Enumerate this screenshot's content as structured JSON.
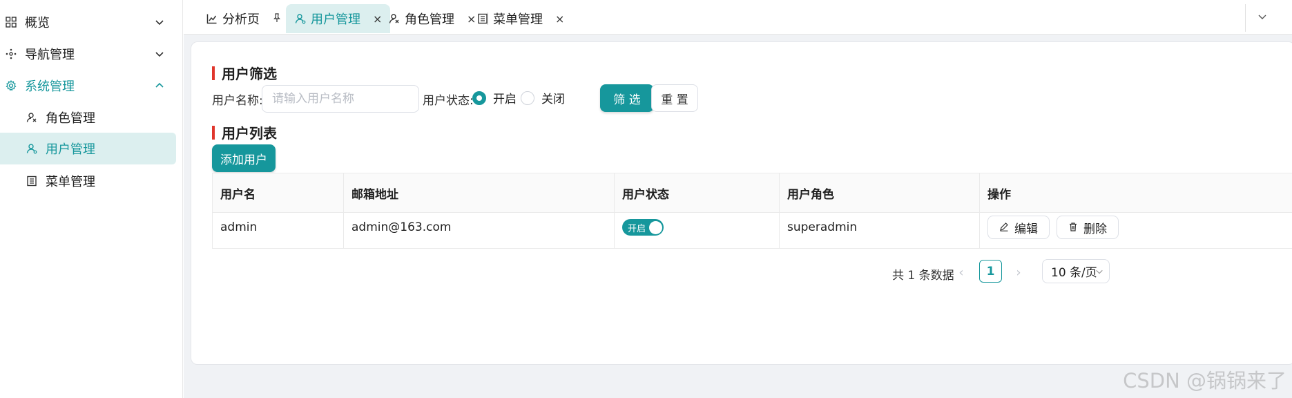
{
  "sidebar": {
    "items": [
      {
        "label": "概览",
        "icon": "dashboard-icon"
      },
      {
        "label": "导航管理",
        "icon": "navigation-icon"
      },
      {
        "label": "系统管理",
        "icon": "gear-icon"
      },
      {
        "label": "角色管理",
        "icon": "role-icon"
      },
      {
        "label": "用户管理",
        "icon": "user-icon"
      },
      {
        "label": "菜单管理",
        "icon": "menu-list-icon"
      }
    ]
  },
  "tabs": [
    {
      "label": "分析页",
      "icon": "chart-icon",
      "action": "pin"
    },
    {
      "label": "用户管理",
      "icon": "user-icon",
      "action": "close"
    },
    {
      "label": "角色管理",
      "icon": "role-icon",
      "action": "close"
    },
    {
      "label": "菜单管理",
      "icon": "menu-list-icon",
      "action": "close"
    }
  ],
  "tab_close_symbol": "×",
  "filter": {
    "title": "用户筛选",
    "name_label": "用户名称:",
    "name_placeholder": "请输入用户名称",
    "name_value": "",
    "status_label": "用户状态:",
    "status_options": [
      "开启",
      "关闭"
    ],
    "status_selected": "开启",
    "filter_button": "筛 选",
    "reset_button": "重 置"
  },
  "list": {
    "title": "用户列表",
    "add_button": "添加用户",
    "columns": [
      "用户名",
      "邮箱地址",
      "用户状态",
      "用户角色",
      "操作"
    ],
    "rows": [
      {
        "username": "admin",
        "email": "admin@163.com",
        "status": "开启",
        "status_on": true,
        "role": "superadmin"
      }
    ],
    "edit_button": "编辑",
    "delete_button": "删除"
  },
  "pagination": {
    "total_text": "共 1 条数据",
    "current_page": "1",
    "page_size": "10 条/页"
  },
  "watermark": "CSDN @锅锅来了",
  "colors": {
    "accent": "#16979c",
    "title_bar": "#e0362c"
  }
}
